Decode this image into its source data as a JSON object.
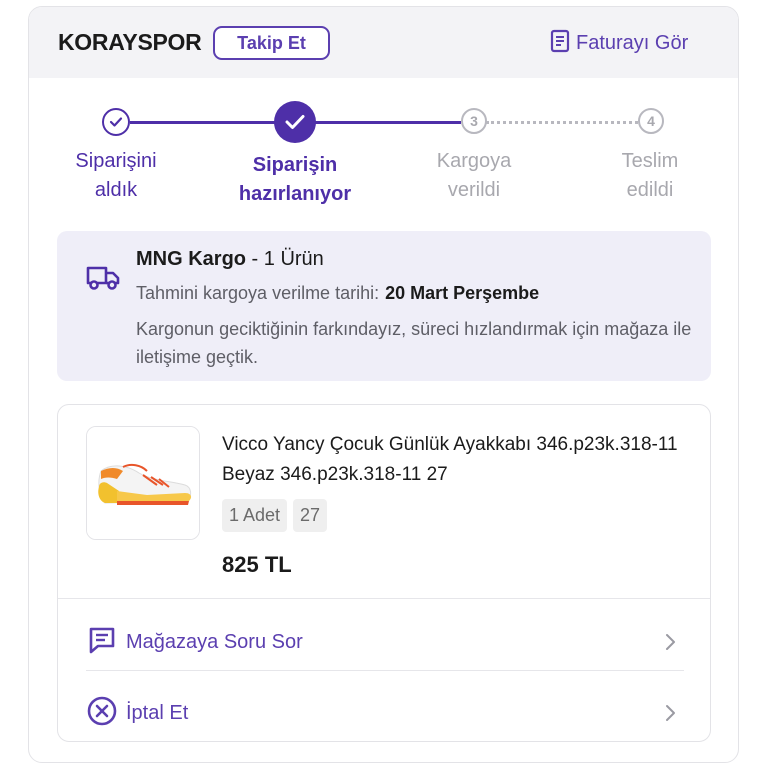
{
  "header": {
    "store_name": "KORAYSPOR",
    "follow_label": "Takip Et",
    "invoice_label": "Faturayı Gör"
  },
  "stepper": {
    "steps": [
      {
        "label_line1": "Siparişini",
        "label_line2": "aldık",
        "state": "done"
      },
      {
        "label_line1": "Siparişin",
        "label_line2": "hazırlanıyor",
        "state": "current"
      },
      {
        "number": "3",
        "label_line1": "Kargoya",
        "label_line2": "verildi",
        "state": "pending"
      },
      {
        "number": "4",
        "label_line1": "Teslim",
        "label_line2": "edildi",
        "state": "pending"
      }
    ]
  },
  "shipment": {
    "carrier": "MNG Kargo",
    "item_count": " - 1 Ürün",
    "estimate_label": "Tahmini kargoya verilme tarihi:",
    "estimate_date": "20 Mart Perşembe",
    "note": "Kargonun geciktiğinin farkındayız, süreci hızlandırmak için mağaza ile iletişime geçtik."
  },
  "product": {
    "title": "Vicco Yancy Çocuk Günlük Ayakkabı 346.p23k.318-11 Beyaz 346.p23k.318-11 27",
    "quantity": "1 Adet",
    "size": "27",
    "price": "825 TL"
  },
  "actions": {
    "ask_store": "Mağazaya Soru Sor",
    "cancel": "İptal Et"
  },
  "colors": {
    "accent": "#5b3fb0",
    "stepper_active": "#4e2fa8",
    "info_bg": "#efeef8",
    "header_bg": "#f3f3f6",
    "muted_text": "#5e5e66",
    "pending": "#a8a8ae"
  }
}
